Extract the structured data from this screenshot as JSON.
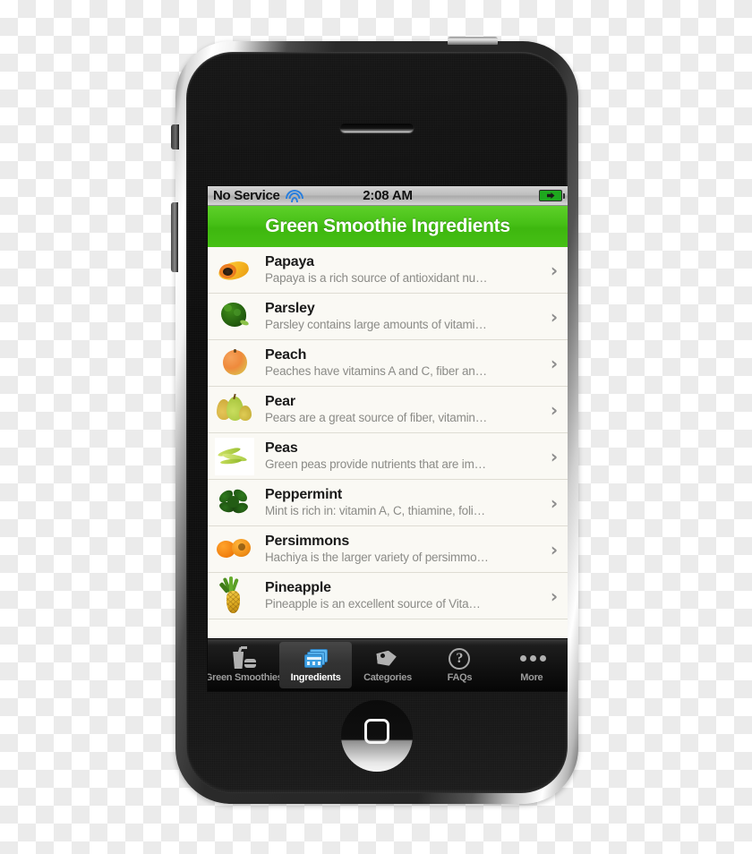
{
  "status_bar": {
    "carrier": "No Service",
    "wifi_icon": "wifi-icon",
    "time": "2:08 AM",
    "battery_icon": "battery-charging-icon"
  },
  "nav_bar": {
    "title": "Green Smoothie Ingredients",
    "background_color": "#45bf15",
    "title_color": "#ffffff"
  },
  "list": {
    "partial_top_row": {
      "name": "",
      "thumb": "cauliflower-thumb"
    },
    "rows": [
      {
        "name": "Papaya",
        "description": "Papaya is a rich source of antioxidant nu…",
        "thumb": "papaya-thumb",
        "chevron": "chevron-right-icon"
      },
      {
        "name": "Parsley",
        "description": "Parsley contains large amounts of vitami…",
        "thumb": "parsley-thumb",
        "chevron": "chevron-right-icon"
      },
      {
        "name": "Peach",
        "description": "Peaches have vitamins A and C, fiber an…",
        "thumb": "peach-thumb",
        "chevron": "chevron-right-icon"
      },
      {
        "name": "Pear",
        "description": "Pears are a great source of fiber, vitamin…",
        "thumb": "pear-thumb",
        "chevron": "chevron-right-icon"
      },
      {
        "name": "Peas",
        "description": "Green peas provide nutrients that are im…",
        "thumb": "peas-thumb",
        "chevron": "chevron-right-icon"
      },
      {
        "name": "Peppermint",
        "description": "Mint is rich in: vitamin A, C, thiamine, foli…",
        "thumb": "peppermint-thumb",
        "chevron": "chevron-right-icon"
      },
      {
        "name": "Persimmons",
        "description": "Hachiya is the larger variety of persimmo…",
        "thumb": "persimmons-thumb",
        "chevron": "chevron-right-icon"
      },
      {
        "name": "Pineapple",
        "description": "Pineapple is an excellent source of Vita…",
        "thumb": "pineapple-thumb",
        "chevron": "chevron-right-icon"
      }
    ]
  },
  "tab_bar": {
    "tabs": [
      {
        "label": "Green Smoothies",
        "icon": "smoothie-glass-icon",
        "selected": false
      },
      {
        "label": "Ingredients",
        "icon": "ingredient-cards-icon",
        "selected": true
      },
      {
        "label": "Categories",
        "icon": "tag-icon",
        "selected": false
      },
      {
        "label": "FAQs",
        "icon": "question-mark-icon",
        "selected": false
      },
      {
        "label": "More",
        "icon": "ellipsis-icon",
        "selected": false
      }
    ]
  },
  "device": {
    "home_button": "home-button",
    "earpiece": "earpiece-speaker",
    "power_button": "power-button",
    "silent_switch": "silent-switch",
    "volume_buttons": "volume-buttons"
  }
}
